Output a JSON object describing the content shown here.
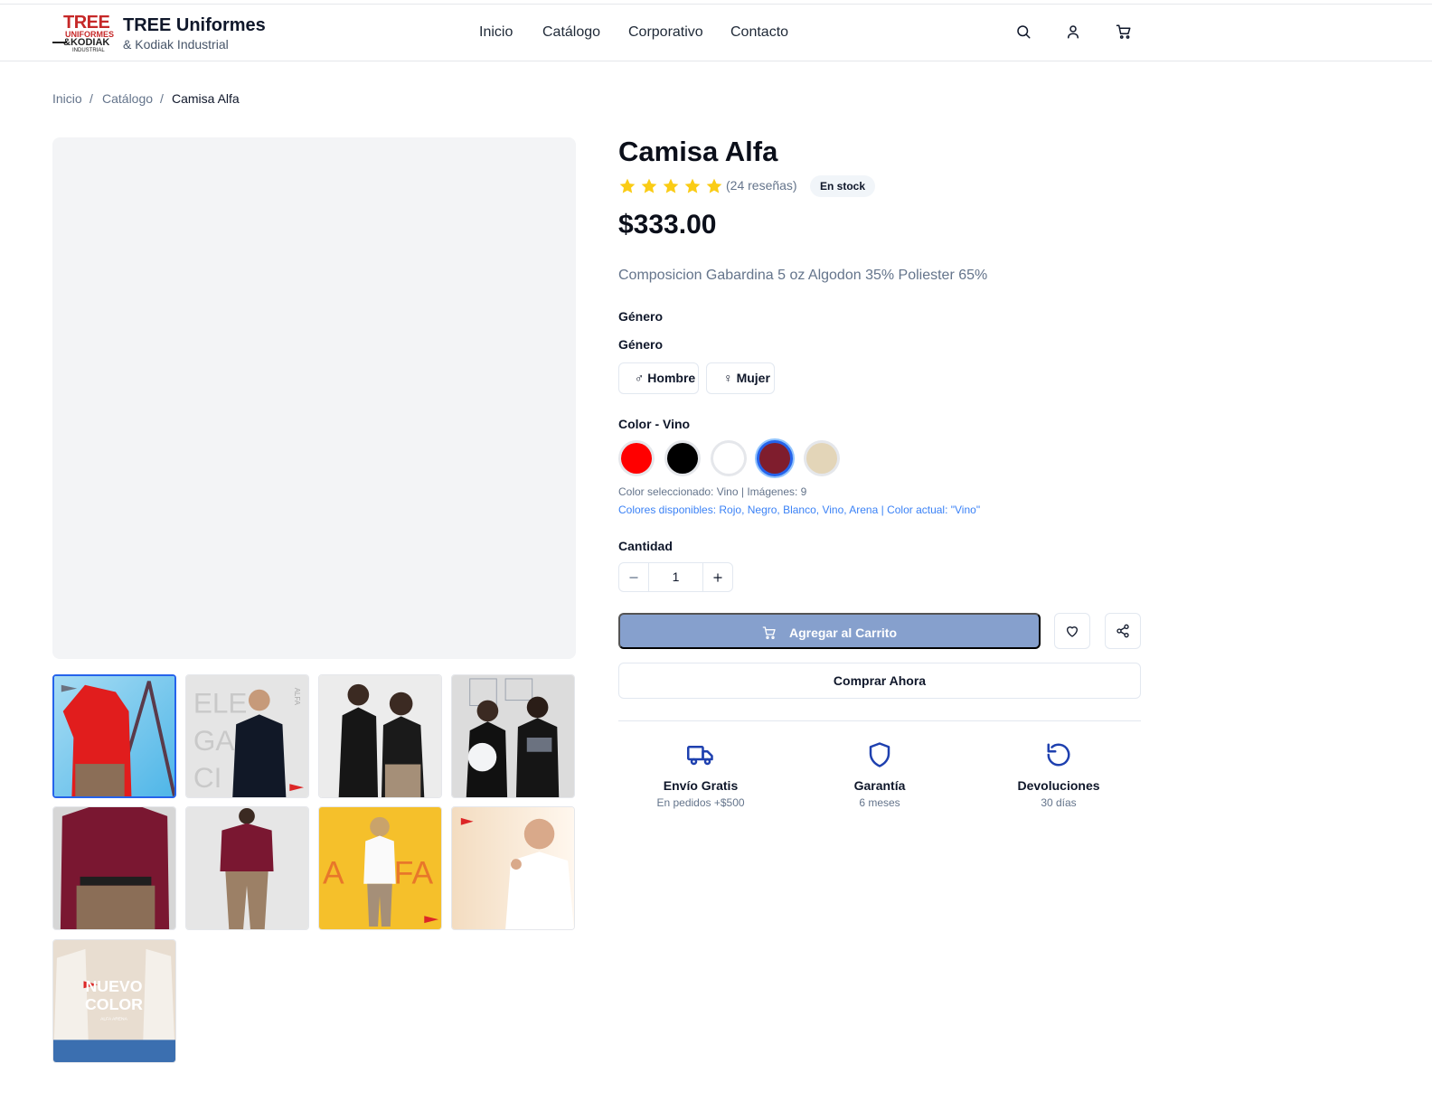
{
  "header": {
    "logo_text": {
      "line1": "TREE",
      "line2": "UNIFORMES",
      "line3": "&KODIAK",
      "line4": "INDUSTRIAL"
    },
    "brand_name": "TREE Uniformes",
    "brand_sub": "& Kodiak Industrial",
    "nav": [
      "Inicio",
      "Catálogo",
      "Corporativo",
      "Contacto"
    ],
    "icons": [
      "search-icon",
      "user-icon",
      "cart-icon"
    ]
  },
  "breadcrumb": {
    "items": [
      "Inicio",
      "Catálogo",
      "Camisa Alfa"
    ],
    "separator": "/"
  },
  "product": {
    "title": "Camisa Alfa",
    "rating": 5,
    "reviews": "(24 reseñas)",
    "stock": "En stock",
    "price": "$333.00",
    "description": "Composicion Gabardina 5 oz Algodon 35% Poliester 65%",
    "gender_heading": "Género",
    "gender_label": "Género",
    "gender_options": [
      {
        "symbol": "♂",
        "label": "Hombre"
      },
      {
        "symbol": "♀",
        "label": "Mujer"
      }
    ],
    "color_label": "Color - Vino",
    "colors": [
      {
        "name": "Rojo",
        "hex": "#ff0000",
        "selected": false
      },
      {
        "name": "Negro",
        "hex": "#000000",
        "selected": false
      },
      {
        "name": "Blanco",
        "hex": "#ffffff",
        "selected": false
      },
      {
        "name": "Vino",
        "hex": "#7f1d2d",
        "selected": true
      },
      {
        "name": "Arena",
        "hex": "#e3d5b8",
        "selected": false
      }
    ],
    "color_selected_text": "Color seleccionado: Vino | Imágenes: 9",
    "colors_available_text": "Colores disponibles: Rojo, Negro, Blanco, Vino, Arena | Color actual: \"Vino\"",
    "quantity_label": "Cantidad",
    "quantity": "1",
    "add_to_cart": "Agregar al Carrito",
    "buy_now": "Comprar Ahora"
  },
  "thumbnails": {
    "count": 9,
    "selected_index": 0,
    "texts": {
      "t2": [
        "ELE",
        "GAN",
        "CI",
        "ALFA"
      ],
      "t7": [
        "A",
        "F",
        "A"
      ],
      "t9": [
        "NUEVO",
        "COLOR",
        "ALFA ARENA"
      ]
    }
  },
  "features": [
    {
      "icon": "truck-icon",
      "title": "Envío Gratis",
      "sub": "En pedidos +$500"
    },
    {
      "icon": "shield-icon",
      "title": "Garantía",
      "sub": "6 meses"
    },
    {
      "icon": "returns-icon",
      "title": "Devoluciones",
      "sub": "30 días"
    }
  ],
  "colors": {
    "accent": "#2563eb",
    "brand_red": "#c62828",
    "star": "#facc15",
    "feature_icon": "#1e40af",
    "add_to_cart_bg": "#86a0cd"
  }
}
